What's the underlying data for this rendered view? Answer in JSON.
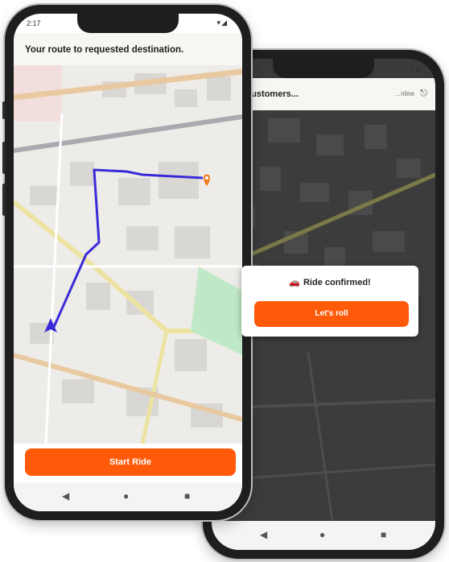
{
  "driver_screen": {
    "status_time": "2:17",
    "status_icons": "▾◢",
    "title": "Your route to requested destination.",
    "start_button_label": "Start Ride",
    "nav": {
      "back": "◀",
      "home": "●",
      "recents": "■"
    }
  },
  "customer_screen": {
    "status_icons": "▾◢",
    "title": "ng For Customers...",
    "offline_text": "…nline",
    "exit_icon": "⎋",
    "dialog": {
      "car_icon": "🚗",
      "title": "Ride confirmed!",
      "button_label": "Let's roll"
    },
    "nav": {
      "back": "◀",
      "home": "●",
      "recents": "■"
    }
  },
  "colors": {
    "accent": "#ff5a0a",
    "route": "#3a2bd8",
    "pin": "#f07a22"
  }
}
